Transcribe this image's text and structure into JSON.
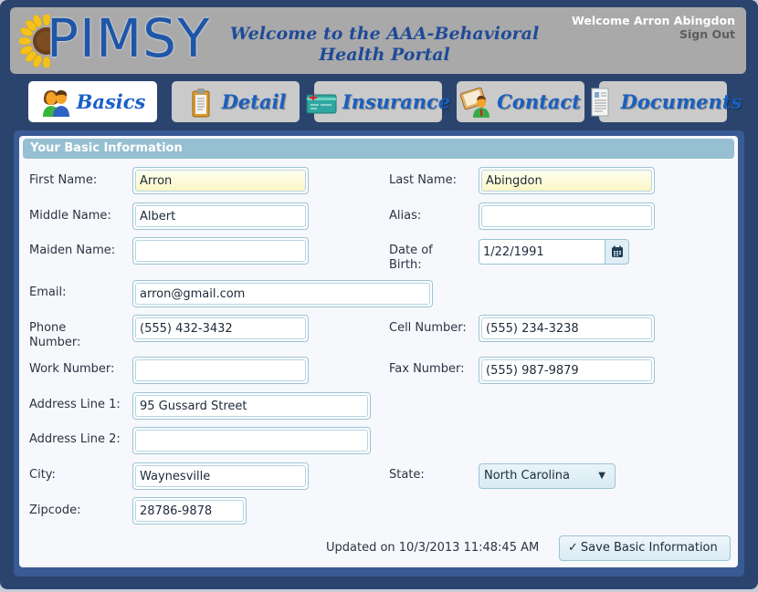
{
  "header": {
    "logo_text": "PIMSY",
    "portal_title": "Welcome to the AAA-Behavioral Health Portal",
    "user_welcome": "Welcome Arron Abingdon",
    "sign_out": "Sign Out"
  },
  "tabs": [
    {
      "label": "Basics",
      "icon": "users-icon",
      "active": true
    },
    {
      "label": "Detail",
      "icon": "clipboard-icon",
      "active": false
    },
    {
      "label": "Insurance",
      "icon": "insurance-card-icon",
      "active": false
    },
    {
      "label": "Contact",
      "icon": "contact-book-icon",
      "active": false
    },
    {
      "label": "Documents",
      "icon": "document-icon",
      "active": false
    }
  ],
  "section": {
    "title": "Your Basic Information"
  },
  "form": {
    "first_name": {
      "label": "First Name:",
      "value": "Arron"
    },
    "last_name": {
      "label": "Last Name:",
      "value": "Abingdon"
    },
    "middle_name": {
      "label": "Middle Name:",
      "value": "Albert"
    },
    "alias": {
      "label": "Alias:",
      "value": ""
    },
    "maiden_name": {
      "label": "Maiden Name:",
      "value": ""
    },
    "dob": {
      "label": "Date of Birth:",
      "value": "1/22/1991"
    },
    "email": {
      "label": "Email:",
      "value": "arron@gmail.com"
    },
    "phone": {
      "label": "Phone Number:",
      "value": "(555) 432-3432"
    },
    "cell": {
      "label": "Cell Number:",
      "value": "(555) 234-3238"
    },
    "work": {
      "label": "Work Number:",
      "value": ""
    },
    "fax": {
      "label": "Fax Number:",
      "value": "(555) 987-9879"
    },
    "address1": {
      "label": "Address Line 1:",
      "value": "95 Gussard Street"
    },
    "address2": {
      "label": "Address Line 2:",
      "value": ""
    },
    "city": {
      "label": "City:",
      "value": "Waynesville"
    },
    "state": {
      "label": "State:",
      "value": "North Carolina"
    },
    "zipcode": {
      "label": "Zipcode:",
      "value": "28786-9878"
    }
  },
  "footer": {
    "updated_text": "Updated on 10/3/2013 11:48:45 AM",
    "save_label": "Save Basic Information"
  },
  "colors": {
    "frame": "#2b446e",
    "header_bg": "#a9a9a9",
    "brand_blue": "#1f56a8",
    "section_header": "#96bfd2",
    "required_field": "#fbf6c4"
  }
}
